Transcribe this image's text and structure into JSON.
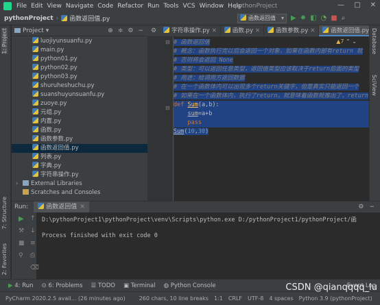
{
  "menubar": {
    "items": [
      "File",
      "Edit",
      "View",
      "Navigate",
      "Code",
      "Refactor",
      "Run",
      "Tools",
      "VCS",
      "Window",
      "Help"
    ],
    "window_title": "pythonProject",
    "window_controls": [
      "—",
      "□",
      "✕"
    ]
  },
  "navbar": {
    "project": "pythonProject",
    "file": "函数返回值.py",
    "run_config": "函数返回值"
  },
  "left_tool_tabs": [
    "1: Project",
    "7: Structure",
    "2: Favorites"
  ],
  "right_tool_tabs": [
    "Database",
    "SciView"
  ],
  "project_panel": {
    "title": "Project",
    "files": [
      "luojiyunsuanfu.py",
      "main.py",
      "python01.py",
      "python02.py",
      "python03.py",
      "shuruheshuchu.py",
      "suanshuyunsuanfu.py",
      "zuoye.py",
      "元组.py",
      "内置.py",
      "函数.py",
      "函数参数.py",
      "函数返回值.py",
      "列表.py",
      "字典.py",
      "字符串操作.py"
    ],
    "selected_index": 12,
    "external": "External Libraries",
    "scratches": "Scratches and Consoles"
  },
  "editor_tabs": [
    {
      "label": "字符串操作.py",
      "active": false
    },
    {
      "label": "函数.py",
      "active": false
    },
    {
      "label": "函数参数.py",
      "active": false
    },
    {
      "label": "函数返回值.py",
      "active": true
    }
  ],
  "inspection": "▲7",
  "code": {
    "comment_lines": [
      "# 函数返回值",
      "# 概念：函数执行完以后会返回一个对象，如果在函数内部有return 就",
      "# 否则将会返回 None",
      "# 类型：可以返回任意类型，返回值类型应该取决于return后面的类型",
      "# 用途：给调用方返回数据",
      "# 在一个函数体内可以出现多个return关键字，但是真实只能返回一个",
      "# 如果在一个函数体内，执行了return，就意味着函数就推出了，return"
    ],
    "def_kw": "def",
    "def_name": "Sum",
    "def_params": "(a,b):",
    "body1_var": "sum",
    "body1_expr": "=a+b",
    "body2": "pass",
    "call_name": "Sum",
    "call_args_open": "(",
    "call_arg1": "10",
    "call_sep": ",",
    "call_arg2": "30",
    "call_close": ")"
  },
  "run_panel": {
    "label": "Run:",
    "tab": "函数返回值",
    "command": "D:\\pythonProject1\\pythonProject\\venv\\Scripts\\python.exe D:/pythonProject1/pythonProject/函",
    "result": "Process finished with exit code 0"
  },
  "bottom_tools": [
    "4: Run",
    "6: Problems",
    "TODO",
    "Terminal",
    "Python Console",
    "Event Log"
  ],
  "status_bar": {
    "message": "PyCharm 2020.2.5 avail... (26 minutes ago)",
    "chars": "260 chars, 10 line breaks",
    "position": "1:1",
    "line_sep": "CRLF",
    "encoding": "UTF-8",
    "indent": "4 spaces",
    "interpreter": "Python 3.9 (pythonProject)"
  },
  "watermark": "CSDN @qianqqqq_lu",
  "colors": {
    "accent": "#4a88c7",
    "selection": "#214283",
    "keyword": "#cc7832",
    "function": "#ffc66d",
    "number": "#6897bb",
    "comment": "#808080",
    "run_green": "#21d789"
  }
}
